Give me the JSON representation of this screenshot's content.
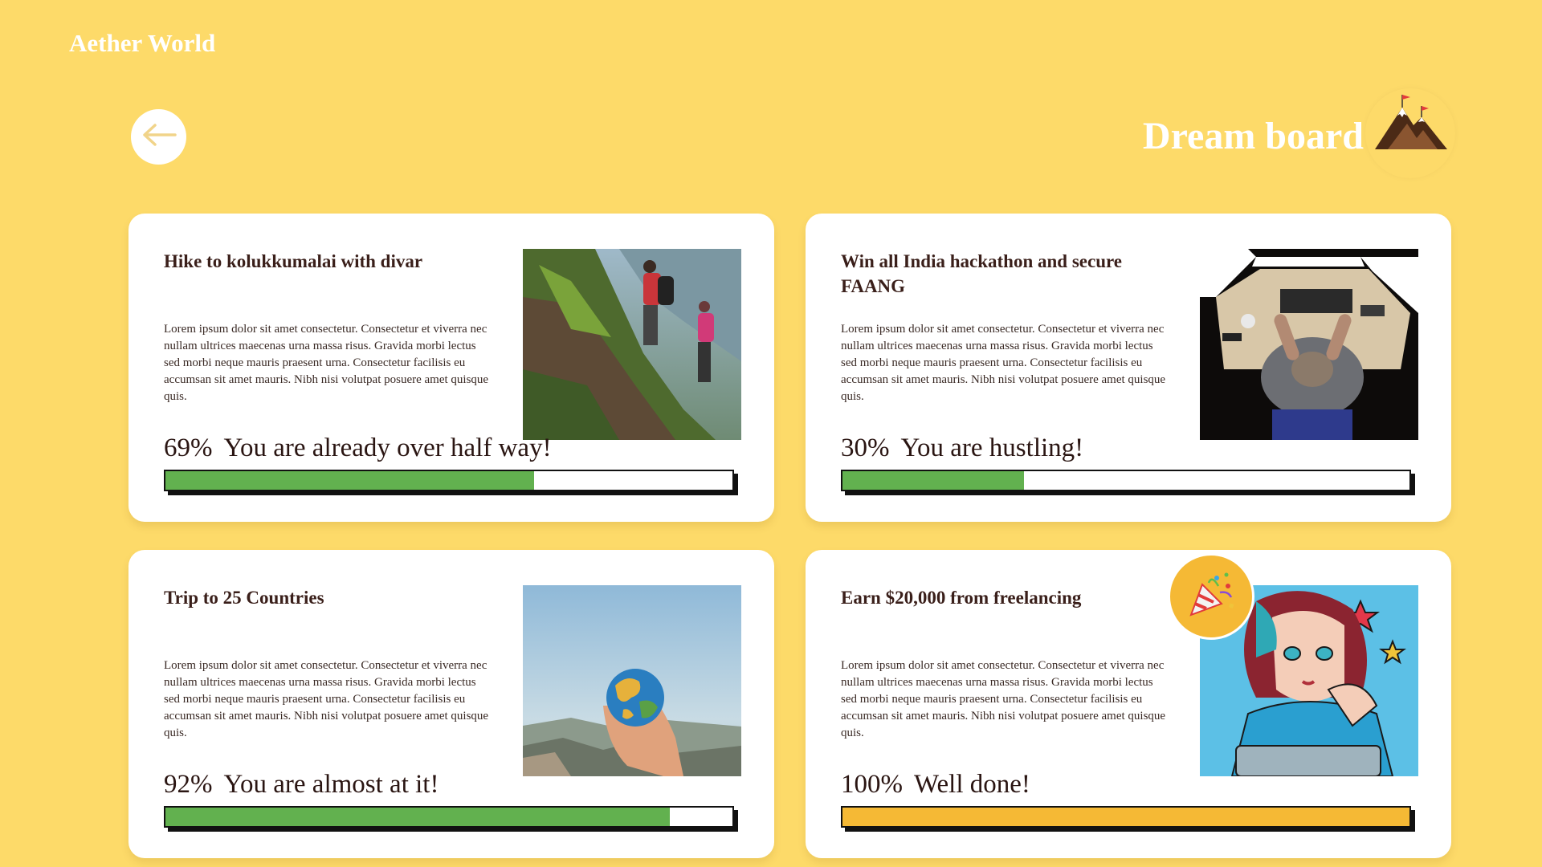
{
  "app": {
    "brand": "Aether World"
  },
  "header": {
    "title": "Dream board",
    "back_icon": "arrow-left-icon",
    "title_icon": "mountain-flags-icon"
  },
  "colors": {
    "background": "#FDDA69",
    "progress_green": "#62B14F",
    "progress_complete": "#F5B935",
    "text_dark": "#3a1f1a"
  },
  "cards": [
    {
      "title": "Hike to kolukkumalai with divar",
      "description": "Lorem ipsum dolor sit amet consectetur. Consectetur et viverra nec nullam ultrices maecenas urna massa risus. Gravida morbi lectus sed morbi neque mauris praesent urna. Consectetur facilisis eu accumsan sit amet mauris. Nibh nisi volutpat posuere amet quisque quis.",
      "percent_label": "69%",
      "message": "You are already over half way!",
      "progress": 0.65,
      "image": "hikers-on-mountain-photo"
    },
    {
      "title": "Win all India hackathon and secure FAANG",
      "description": "Lorem ipsum dolor sit amet consectetur. Consectetur et viverra nec nullam ultrices maecenas urna massa risus. Gravida morbi lectus sed morbi neque mauris praesent urna. Consectetur facilisis eu accumsan sit amet mauris. Nibh nisi volutpat posuere amet quisque quis.",
      "percent_label": "30%",
      "message": "You are hustling!",
      "progress": 0.32,
      "image": "person-at-desk-photo"
    },
    {
      "title": "Trip to 25 Countries",
      "description": "Lorem ipsum dolor sit amet consectetur. Consectetur et viverra nec nullam ultrices maecenas urna massa risus. Gravida morbi lectus sed morbi neque mauris praesent urna. Consectetur facilisis eu accumsan sit amet mauris. Nibh nisi volutpat posuere amet quisque quis.",
      "percent_label": "92%",
      "message": "You are almost at it!",
      "progress": 0.89,
      "image": "hand-holding-globe-photo"
    },
    {
      "title": "Earn $20,000 from freelancing",
      "description": "Lorem ipsum dolor sit amet consectetur. Consectetur et viverra nec nullam ultrices maecenas urna massa risus. Gravida morbi lectus sed morbi neque mauris praesent urna. Consectetur facilisis eu accumsan sit amet mauris. Nibh nisi volutpat posuere amet quisque quis.",
      "percent_label": "100%",
      "message": "Well done!",
      "progress": 1.0,
      "image": "comic-girl-illustration",
      "badge_icon": "party-popper-icon"
    }
  ]
}
